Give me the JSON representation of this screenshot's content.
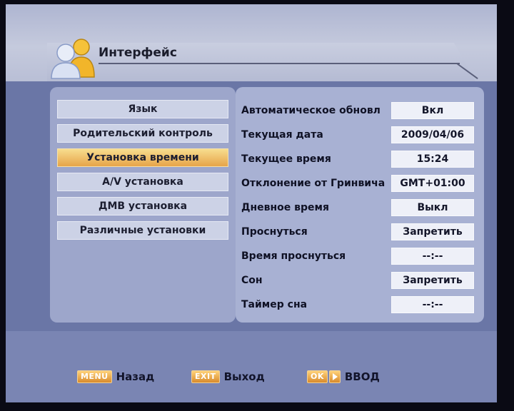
{
  "header": {
    "title": "Интерфейс",
    "icon": "users-icon"
  },
  "menu": {
    "items": [
      {
        "label": "Язык",
        "active": false
      },
      {
        "label": "Родительский контроль",
        "active": false
      },
      {
        "label": "Установка времени",
        "active": true
      },
      {
        "label": "A/V установка",
        "active": false
      },
      {
        "label": "ДМВ установка",
        "active": false
      },
      {
        "label": "Различные установки",
        "active": false
      }
    ]
  },
  "settings": [
    {
      "label": "Автоматическое обновл",
      "value": "Вкл"
    },
    {
      "label": "Текущая дата",
      "value": "2009/04/06"
    },
    {
      "label": "Текущее время",
      "value": "15:24"
    },
    {
      "label": "Отклонение от Гринвича",
      "value": "GMT+01:00"
    },
    {
      "label": "Дневное время",
      "value": "Выкл"
    },
    {
      "label": "Проснуться",
      "value": "Запретить"
    },
    {
      "label": "Время проснуться",
      "value": "--:--"
    },
    {
      "label": "Сон",
      "value": "Запретить"
    },
    {
      "label": "Таймер сна",
      "value": "--:--"
    }
  ],
  "footer": {
    "menu_key": "MENU",
    "menu_label": "Назад",
    "exit_key": "EXIT",
    "exit_label": "Выход",
    "ok_key": "OK",
    "ok_label": "ВВОД"
  },
  "colors": {
    "accent": "#e7a449",
    "background": "#6a76a6",
    "panel": "#9da6cb"
  }
}
